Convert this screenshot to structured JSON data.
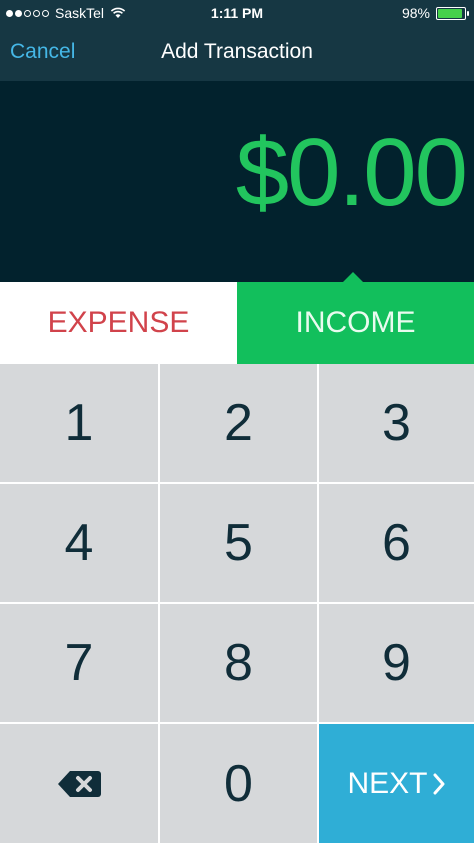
{
  "status": {
    "carrier": "SaskTel",
    "time": "1:11 PM",
    "battery": "98%",
    "battery_color": "#45d14a"
  },
  "nav": {
    "cancel": "Cancel",
    "title": "Add Transaction"
  },
  "amount": {
    "value": "$0.00",
    "color": "#22c55e"
  },
  "toggle": {
    "expense": "EXPENSE",
    "income": "INCOME",
    "selected": "INCOME",
    "expense_color": "#d1434b",
    "income_bg": "#12bf5c"
  },
  "keypad": {
    "keys": [
      "1",
      "2",
      "3",
      "4",
      "5",
      "6",
      "7",
      "8",
      "9",
      "0"
    ],
    "next": "NEXT",
    "backspace_icon": "backspace-icon",
    "next_color": "#2faed6"
  }
}
